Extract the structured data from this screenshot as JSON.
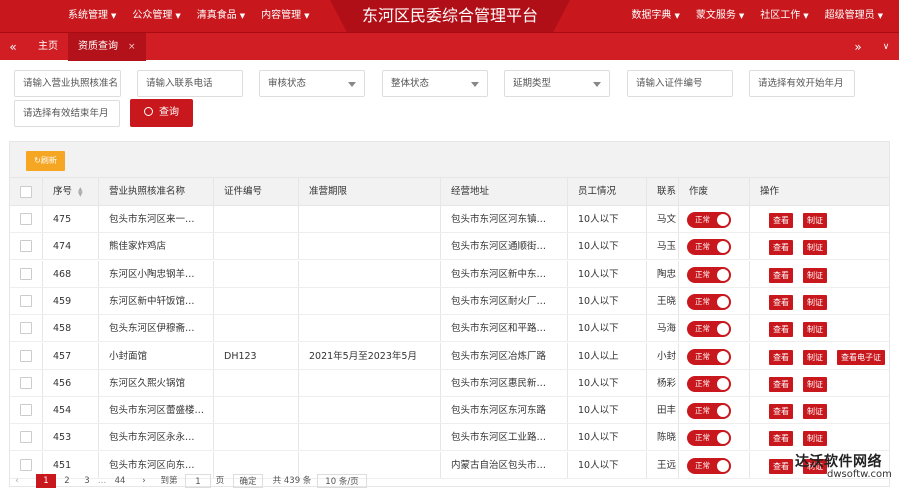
{
  "header": {
    "title": "东河区民委综合管理平台",
    "left_menu": [
      "系统管理",
      "公众管理",
      "清真食品",
      "内容管理"
    ],
    "right_menu": [
      "数据字典",
      "蒙文服务",
      "社区工作",
      "超级管理员"
    ]
  },
  "tabs": {
    "home": "主页",
    "active": "资质查询",
    "close": "×"
  },
  "filters": {
    "license_name": "请输入营业执照核准名",
    "phone": "请输入联系电话",
    "audit_status": "审核状态",
    "overall_status": "整体状态",
    "extension_type": "延期类型",
    "cert_no": "请输入证件编号",
    "valid_start": "请选择有效开始年月",
    "valid_end": "请选择有效结束年月",
    "query": "查询"
  },
  "toolbar": {
    "refresh": "刷新"
  },
  "columns": [
    "序号",
    "营业执照核准名称",
    "证件编号",
    "准营期限",
    "经营地址",
    "员工情况",
    "联系",
    "作废",
    "操作"
  ],
  "rows": [
    {
      "id": "475",
      "name": "包头市东河区来一…",
      "cert": "",
      "term": "",
      "addr": "包头市东河区河东镇…",
      "staff": "10人以下",
      "contact": "马文",
      "status": "正常",
      "ops": [
        "查看",
        "制证"
      ]
    },
    {
      "id": "474",
      "name": "熊佳家炸鸡店",
      "cert": "",
      "term": "",
      "addr": "包头市东河区通顺街…",
      "staff": "10人以下",
      "contact": "马玉",
      "status": "正常",
      "ops": [
        "查看",
        "制证"
      ]
    },
    {
      "id": "468",
      "name": "东河区小陶忠钢羊…",
      "cert": "",
      "term": "",
      "addr": "包头市东河区新中东…",
      "staff": "10人以下",
      "contact": "陶忠",
      "status": "正常",
      "ops": [
        "查看",
        "制证"
      ]
    },
    {
      "id": "459",
      "name": "东河区新中轩饭馆…",
      "cert": "",
      "term": "",
      "addr": "包头市东河区耐火厂…",
      "staff": "10人以下",
      "contact": "王晓",
      "status": "正常",
      "ops": [
        "查看",
        "制证"
      ]
    },
    {
      "id": "458",
      "name": "包头东河区伊穆斋…",
      "cert": "",
      "term": "",
      "addr": "包头市东河区和平路…",
      "staff": "10人以下",
      "contact": "马海",
      "status": "正常",
      "ops": [
        "查看",
        "制证"
      ]
    },
    {
      "id": "457",
      "name": "小封面馆",
      "cert": "DH123",
      "term": "2021年5月至2023年5月",
      "addr": "包头市东河区冶炼厂路",
      "staff": "10人以上",
      "contact": "小封",
      "status": "正常",
      "ops": [
        "查看",
        "制证",
        "查看电子证"
      ]
    },
    {
      "id": "456",
      "name": "东河区久熙火锅馆",
      "cert": "",
      "term": "",
      "addr": "包头市东河区惠民新…",
      "staff": "10人以下",
      "contact": "杨彩",
      "status": "正常",
      "ops": [
        "查看",
        "制证"
      ]
    },
    {
      "id": "454",
      "name": "包头市东河区蕾盛楼…",
      "cert": "",
      "term": "",
      "addr": "包头市东河区东河东路",
      "staff": "10人以下",
      "contact": "田丰",
      "status": "正常",
      "ops": [
        "查看",
        "制证"
      ]
    },
    {
      "id": "453",
      "name": "包头市东河区永永…",
      "cert": "",
      "term": "",
      "addr": "包头市东河区工业路…",
      "staff": "10人以下",
      "contact": "陈晓",
      "status": "正常",
      "ops": [
        "查看",
        "制证"
      ]
    },
    {
      "id": "451",
      "name": "包头市东河区向东…",
      "cert": "",
      "term": "",
      "addr": "内蒙古自治区包头市…",
      "staff": "10人以下",
      "contact": "王远",
      "status": "正常",
      "ops": [
        "查看",
        "制证"
      ]
    }
  ],
  "pager": {
    "pages": [
      "1",
      "2",
      "3",
      "44"
    ],
    "goto": "到第",
    "page_input": "1",
    "page_unit": "页",
    "confirm": "确定",
    "total": "共 439 条",
    "page_size": "10 条/页"
  },
  "watermark": {
    "line1": "达沃软件网络",
    "line2": "dwsoftw.com"
  }
}
